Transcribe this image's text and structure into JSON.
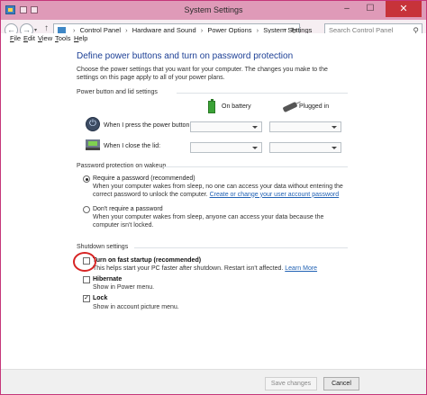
{
  "window": {
    "title": "System Settings",
    "minimize": "–",
    "maximize": "☐",
    "close": "✕"
  },
  "address": {
    "back": "←",
    "forward": "→",
    "up": "↑",
    "recent": "▾",
    "crumbs": [
      "Control Panel",
      "Hardware and Sound",
      "Power Options",
      "System Settings"
    ],
    "separator": "›",
    "search_placeholder": "Search Control Panel"
  },
  "menu": [
    "File",
    "Edit",
    "View",
    "Tools",
    "Help"
  ],
  "page": {
    "title": "Define power buttons and turn on password protection",
    "description": "Choose the power settings that you want for your computer. The changes you make to the settings on this page apply to all of your power plans."
  },
  "power_group": {
    "label": "Power button and lid settings",
    "col_battery": "On battery",
    "col_plugged": "Plugged in",
    "rows": [
      {
        "label": "When I press the power button:",
        "icon": "power-button-icon"
      },
      {
        "label": "When I close the lid:",
        "icon": "laptop-lid-icon"
      }
    ]
  },
  "password_group": {
    "label": "Password protection on wakeup",
    "require": {
      "title": "Require a password (recommended)",
      "desc": "When your computer wakes from sleep, no one can access your data without entering the correct password to unlock the computer.",
      "link": "Create or change your user account password",
      "checked": true
    },
    "dont_require": {
      "title": "Don't require a password",
      "desc": "When your computer wakes from sleep, anyone can access your data because the computer isn't locked.",
      "checked": false
    }
  },
  "shutdown_group": {
    "label": "Shutdown settings",
    "items": [
      {
        "title": "Turn on fast startup (recommended)",
        "desc": "This helps start your PC faster after shutdown. Restart isn't affected.",
        "link": "Learn More",
        "checked": false
      },
      {
        "title": "Hibernate",
        "desc": "Show in Power menu.",
        "checked": false
      },
      {
        "title": "Lock",
        "desc": "Show in account picture menu.",
        "checked": true
      }
    ]
  },
  "footer": {
    "save": "Save changes",
    "cancel": "Cancel"
  },
  "check_mark": "✓"
}
